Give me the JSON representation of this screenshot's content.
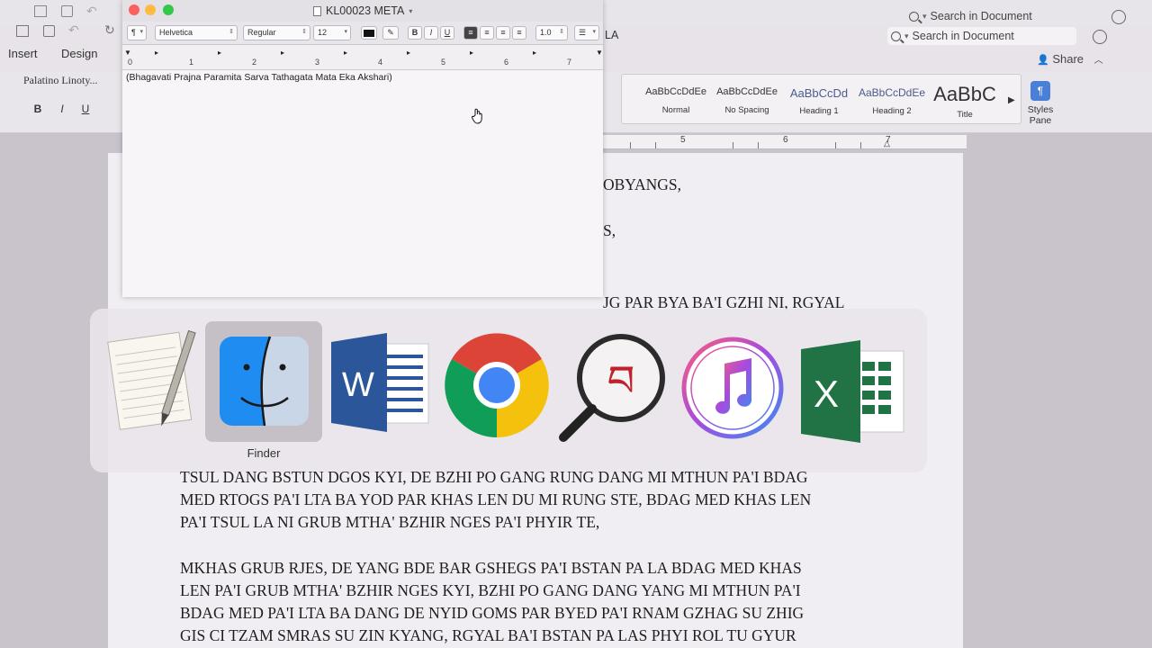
{
  "textedit": {
    "title": "KL00023 META",
    "font_family": "Helvetica",
    "font_style": "Regular",
    "font_size": "12",
    "line_spacing": "1.0",
    "bold": "B",
    "italic": "I",
    "underline": "U",
    "paragraph_style": "¶",
    "body_text": "(Bhagavati Prajna Paramita Sarva Tathagata Mata Eka Akshari)",
    "ruler_numbers": [
      "0",
      "1",
      "2",
      "3",
      "4",
      "5",
      "6",
      "7"
    ]
  },
  "word": {
    "tabs": [
      "Insert",
      "Design"
    ],
    "tab_fragment": "LA",
    "search_placeholder": "Search in Document",
    "share_label": "Share",
    "font_name": "Palatino Linoty...",
    "format_buttons": [
      "B",
      "I",
      "U"
    ],
    "styles": [
      {
        "sample": "AaBbCcDdEe",
        "name": "Normal"
      },
      {
        "sample": "AaBbCcDdEe",
        "name": "No Spacing"
      },
      {
        "sample": "AaBbCcDd",
        "name": "Heading 1"
      },
      {
        "sample": "AaBbCcDdEe",
        "name": "Heading 2"
      },
      {
        "sample": "AaBbC",
        "name": "Title"
      }
    ],
    "styles_pane_label": "Styles Pane",
    "ruler_numbers": [
      "5",
      "6",
      "7"
    ],
    "doc_fragments": [
      "OBYANGS,",
      "S,",
      "JG PAR BYA BA'I GZHI NI, RGYAL"
    ],
    "paragraph1": [
      "TSUL DANG BSTUN DGOS KYI, DE BZHI PO GANG RUNG DANG MI MTHUN PA'I BDAG",
      "MED RTOGS PA'I LTA BA YOD PAR KHAS LEN DU MI RUNG STE, BDAG MED KHAS LEN",
      "PA'I TSUL LA NI GRUB MTHA' BZHIR NGES PA'I PHYIR TE,"
    ],
    "paragraph2": [
      "MKHAS GRUB RJES, DE YANG BDE BAR GSHEGS PA'I BSTAN PA LA BDAG MED KHAS",
      "LEN PA'I GRUB MTHA' BZHIR NGES KYI, BZHI PO GANG DANG YANG MI MTHUN PA'I",
      "BDAG MED PA'I LTA BA DANG DE NYID GOMS PAR BYED PA'I RNAM GZHAG SU ZHIG",
      "GIS CI TZAM SMRAS SU ZIN KYANG, RGYAL BA'I BSTAN PA LAS PHYI ROL TU GYUR"
    ]
  },
  "app_switcher": {
    "apps": [
      {
        "name": "TextEdit",
        "icon": "textedit-icon"
      },
      {
        "name": "Finder",
        "icon": "finder-icon"
      },
      {
        "name": "Microsoft Word",
        "icon": "word-icon"
      },
      {
        "name": "Google Chrome",
        "icon": "chrome-icon"
      },
      {
        "name": "Tibetan Search",
        "icon": "tibetan-search-icon"
      },
      {
        "name": "iTunes",
        "icon": "itunes-icon"
      },
      {
        "name": "Microsoft Excel",
        "icon": "excel-icon"
      }
    ],
    "selected_label": "Finder",
    "tibetan_glyph": "བ"
  },
  "colors": {
    "close": "#fc605c",
    "minimize": "#fdbc40",
    "zoom": "#34c84a",
    "word_blue": "#2b579a",
    "excel_green": "#217346"
  }
}
